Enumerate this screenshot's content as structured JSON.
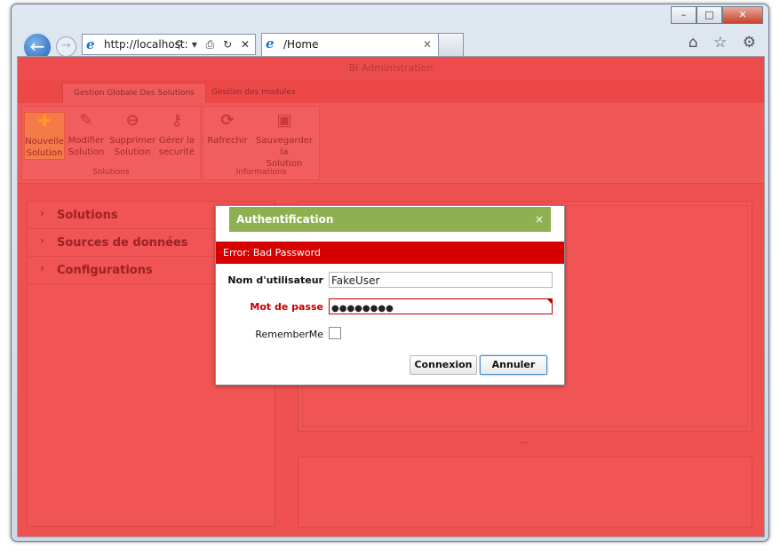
{
  "browser": {
    "window_controls": {
      "minimize": "–",
      "maximize": "□",
      "close": "✕"
    },
    "address": "http://localhost:",
    "address_tools": "⚲ ▾ ⎙ ↻ ✕",
    "tab_title": "/Home",
    "tab_close": "✕",
    "toolbar_icons": [
      "home-icon",
      "star-icon",
      "gear-icon"
    ],
    "toolbar_glyphs": "⌂ ☆ ⚙"
  },
  "app": {
    "title": "BI Administration",
    "ribbon_tabs": [
      "Gestion Globale Des Solutions",
      "Gestion des modules"
    ],
    "groups": [
      {
        "label": "Solutions",
        "buttons": [
          {
            "line1": "Nouvelle",
            "line2": "Solution",
            "icon": "plus-icon",
            "glyph": "✚"
          },
          {
            "line1": "Modifier",
            "line2": "Solution",
            "icon": "edit-icon",
            "glyph": "✎"
          },
          {
            "line1": "Supprimer",
            "line2": "Solution",
            "icon": "delete-icon",
            "glyph": "⊖"
          },
          {
            "line1": "Gérer la",
            "line2": "securité",
            "icon": "key-icon",
            "glyph": "⚷"
          }
        ]
      },
      {
        "label": "Informations",
        "buttons": [
          {
            "line1": "Rafrechir",
            "line2": "",
            "icon": "refresh-icon",
            "glyph": "⟳"
          },
          {
            "line1": "Sauvegarder la",
            "line2": "Solution",
            "icon": "save-icon",
            "glyph": "▣"
          }
        ]
      }
    ],
    "accordion": [
      "Solutions",
      "Sources de données",
      "Configurations"
    ],
    "colors": {
      "overlay": "#ef5151",
      "dialog_header": "#8fb050",
      "error_bar": "#d70000"
    }
  },
  "dialog": {
    "title": "Authentification",
    "close": "×",
    "error": "Error: Bad Password",
    "username_label": "Nom d'utilisateur",
    "username_value": "FakeUser",
    "password_label": "Mot de passe",
    "password_value": "●●●●●●●●",
    "remember_label": "RememberMe",
    "remember_checked": false,
    "connect_button": "Connexion",
    "cancel_button": "Annuler"
  }
}
